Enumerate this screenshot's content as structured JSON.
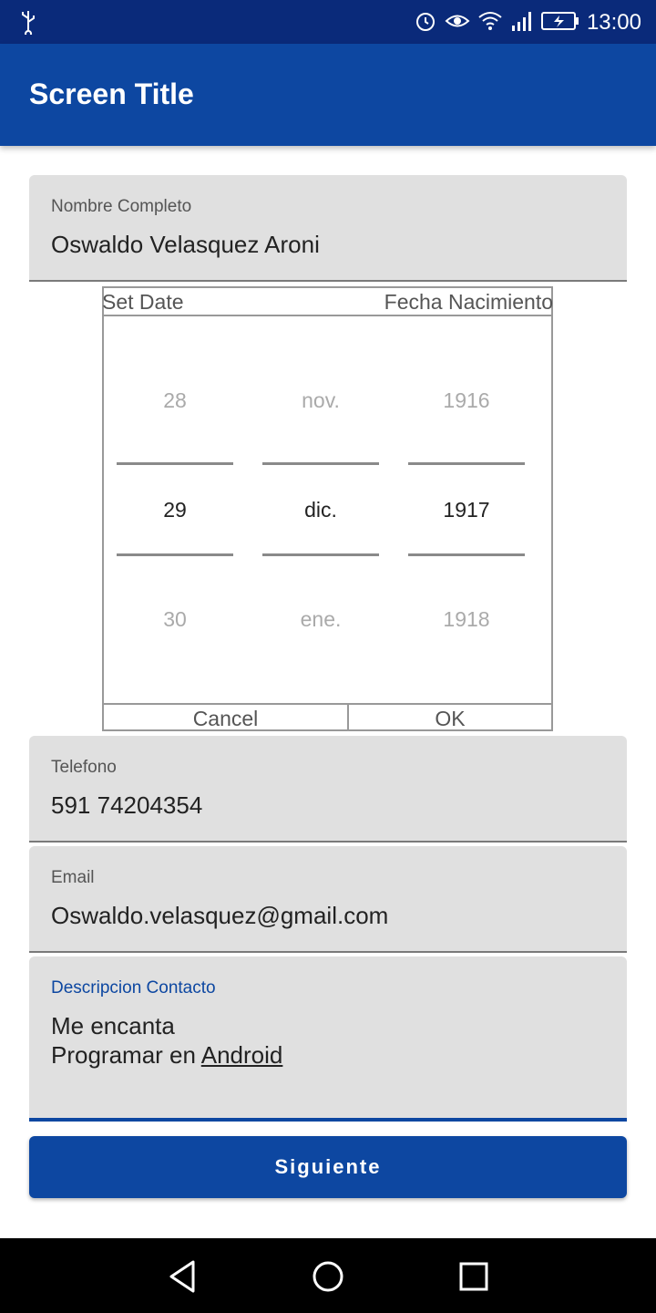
{
  "status_bar": {
    "time": "13:00",
    "icons": [
      "usb-icon",
      "alarm-icon",
      "eye-icon",
      "wifi-icon",
      "signal-icon",
      "battery-icon"
    ]
  },
  "app_bar": {
    "title": "Screen Title"
  },
  "form": {
    "nombre": {
      "label": "Nombre Completo",
      "value": "Oswaldo Velasquez Aroni"
    },
    "telefono": {
      "label": "Telefono",
      "value": "591 74204354"
    },
    "email": {
      "label": "Email",
      "value": "Oswaldo.velasquez@gmail.com"
    },
    "descripcion": {
      "label": "Descripcion Contacto",
      "line1": "Me encanta",
      "line2_prefix": "Programar en ",
      "line2_link": "Android"
    },
    "submit_label": "Siguiente"
  },
  "date_picker": {
    "header_left": "Set Date",
    "header_right": "Fecha Nacimiento",
    "day": {
      "prev": "28",
      "selected": "29",
      "next": "30"
    },
    "month": {
      "prev": "nov.",
      "selected": "dic.",
      "next": "ene."
    },
    "year": {
      "prev": "1916",
      "selected": "1917",
      "next": "1918"
    },
    "cancel_label": "Cancel",
    "ok_label": "OK"
  },
  "colors": {
    "primary": "#0d47a1",
    "status_bar": "#0a2a7a",
    "field_bg": "#e0e0e0"
  }
}
